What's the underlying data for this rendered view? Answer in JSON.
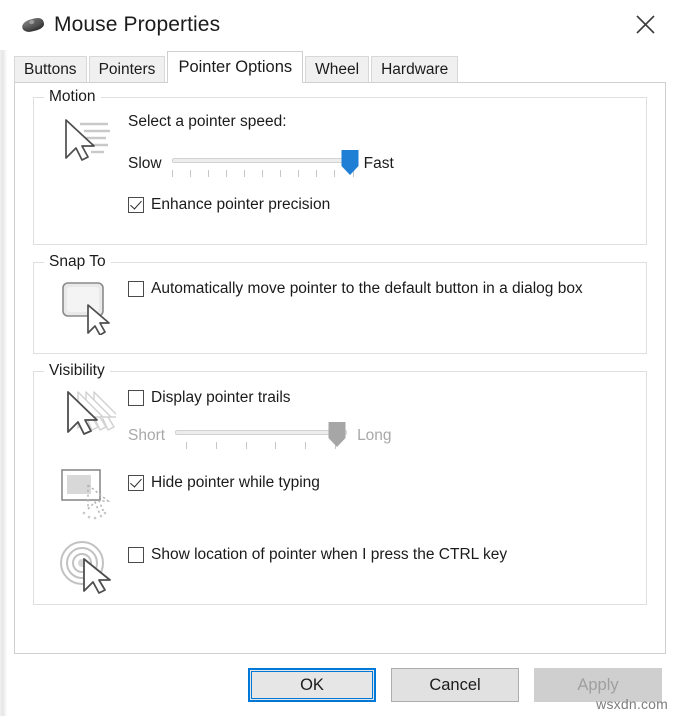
{
  "window": {
    "title": "Mouse Properties",
    "icon": "mouse-icon",
    "close_label": "✕"
  },
  "tabs": [
    {
      "label": "Buttons",
      "selected": false
    },
    {
      "label": "Pointers",
      "selected": false
    },
    {
      "label": "Pointer Options",
      "selected": true
    },
    {
      "label": "Wheel",
      "selected": false
    },
    {
      "label": "Hardware",
      "selected": false
    }
  ],
  "motion": {
    "group_title": "Motion",
    "icon": "pointer-speed-icon",
    "heading": "Select a pointer speed:",
    "slider": {
      "min_label": "Slow",
      "max_label": "Fast",
      "value_percent": 100,
      "ticks": 11,
      "enabled": true,
      "thumb_color": "#1e7fd4"
    },
    "checkbox": {
      "label": "Enhance pointer precision",
      "checked": true
    }
  },
  "snap_to": {
    "group_title": "Snap To",
    "icon": "default-button-snap-icon",
    "checkbox": {
      "label": "Automatically move pointer to the default button in a dialog box",
      "checked": false
    }
  },
  "visibility": {
    "group_title": "Visibility",
    "trails": {
      "icon": "pointer-trails-icon",
      "checkbox": {
        "label": "Display pointer trails",
        "checked": false
      },
      "slider": {
        "min_label": "Short",
        "max_label": "Long",
        "value_percent": 82,
        "ticks": 6,
        "enabled": false,
        "thumb_color": "#9a9a9a"
      }
    },
    "hide_typing": {
      "icon": "hide-pointer-typing-icon",
      "checkbox": {
        "label": "Hide pointer while typing",
        "checked": true
      }
    },
    "show_location": {
      "icon": "ctrl-locate-pointer-icon",
      "checkbox": {
        "label": "Show location of pointer when I press the CTRL key",
        "checked": false
      }
    }
  },
  "footer": {
    "ok_label": "OK",
    "cancel_label": "Cancel",
    "apply_label": "Apply",
    "apply_enabled": false,
    "accent_color": "#0078d7"
  },
  "watermark": {
    "text": "wsxdn.com"
  }
}
